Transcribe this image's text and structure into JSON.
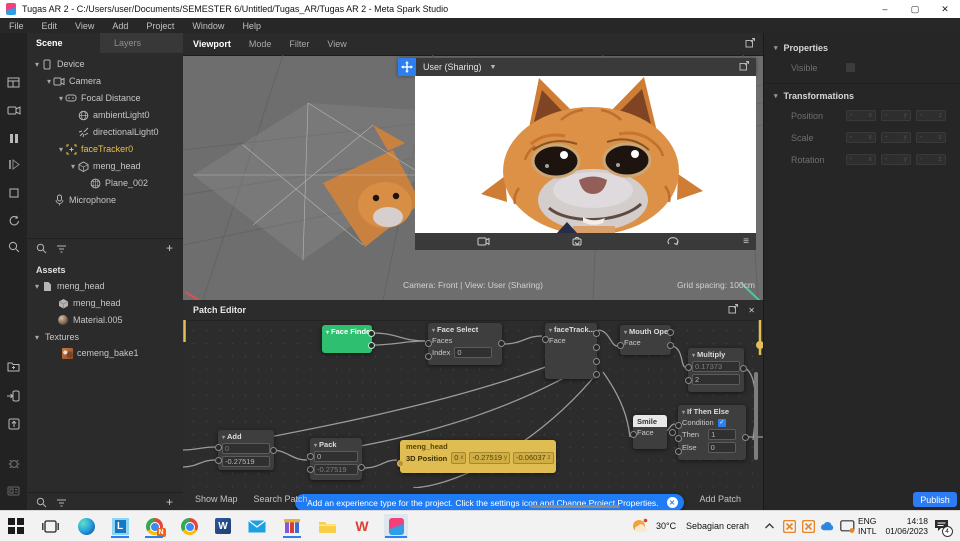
{
  "titlebar": {
    "title": "Tugas AR 2 - C:/Users/user/Documents/SEMESTER 6/Untitled/Tugas_AR/Tugas AR 2 - Meta Spark Studio",
    "minimize": "–",
    "maximize": "▢",
    "close": "✕"
  },
  "menu": {
    "items": [
      "File",
      "Edit",
      "View",
      "Add",
      "Project",
      "Window",
      "Help"
    ]
  },
  "scene": {
    "tab_scene": "Scene",
    "tab_layers": "Layers",
    "items": [
      {
        "label": "Device"
      },
      {
        "label": "Camera"
      },
      {
        "label": "Focal Distance"
      },
      {
        "label": "ambientLight0"
      },
      {
        "label": "directionalLight0"
      },
      {
        "label": "faceTracker0"
      },
      {
        "label": "meng_head"
      },
      {
        "label": "Plane_002"
      },
      {
        "label": "Microphone"
      }
    ]
  },
  "assets": {
    "title": "Assets",
    "items": [
      {
        "label": "meng_head"
      },
      {
        "label": "meng_head"
      },
      {
        "label": "Material.005"
      },
      {
        "label": "Textures"
      },
      {
        "label": "cemeng_bake1"
      }
    ]
  },
  "viewport": {
    "tabs": [
      "Viewport",
      "Mode",
      "Filter",
      "View"
    ],
    "simulator_label": "User (Sharing)",
    "status": "Camera: Front | View: User (Sharing)",
    "grid": "Grid spacing: 100cm"
  },
  "patch": {
    "title": "Patch Editor",
    "nodes": {
      "face_finder": {
        "title": "Face Finder"
      },
      "face_select": {
        "title": "Face Select",
        "faces_label": "Faces",
        "index_label": "Index",
        "index_value": "0"
      },
      "face_tracker": {
        "title": "faceTrack...",
        "face_label": "Face"
      },
      "mouth_open": {
        "title": "Mouth Open",
        "face_label": "Face"
      },
      "multiply": {
        "title": "Multiply",
        "input1": "0.17373",
        "input2": "2"
      },
      "smile": {
        "title": "Smile",
        "face_label": "Face"
      },
      "if_then_else": {
        "title": "If Then Else",
        "condition_label": "Condition",
        "check": "✓",
        "then_label": "Then",
        "then_value": "1",
        "else_label": "Else",
        "else_value": "0"
      },
      "add": {
        "title": "Add",
        "input1": "0",
        "input2": "-0.27519"
      },
      "pack": {
        "title": "Pack",
        "input1": "0",
        "input2": "-0.27519"
      },
      "meng_head": {
        "title": "meng_head",
        "position_label": "3D Position",
        "x": "0",
        "y": "-0.27519",
        "z": "-0.06037"
      }
    },
    "notification": "Add an experience type for the project. Click the settings icon and Change Project Properties.",
    "notification_close": "✕",
    "show_map": "Show Map",
    "search_patch": "Search Patch",
    "add_patch": "Add Patch"
  },
  "inspector": {
    "properties": "Properties",
    "visible": "Visible",
    "transformations": "Transformations",
    "position": "Position",
    "scale": "Scale",
    "rotation": "Rotation",
    "placeholder": "-",
    "axes": [
      "x",
      "y",
      "z"
    ],
    "publish": "Publish"
  },
  "taskbar": {
    "temp": "30°C",
    "weather": "Sebagian cerah",
    "lang1": "ENG",
    "lang2": "INTL",
    "time": "14:18",
    "date": "01/06/2023",
    "badge": "4"
  }
}
